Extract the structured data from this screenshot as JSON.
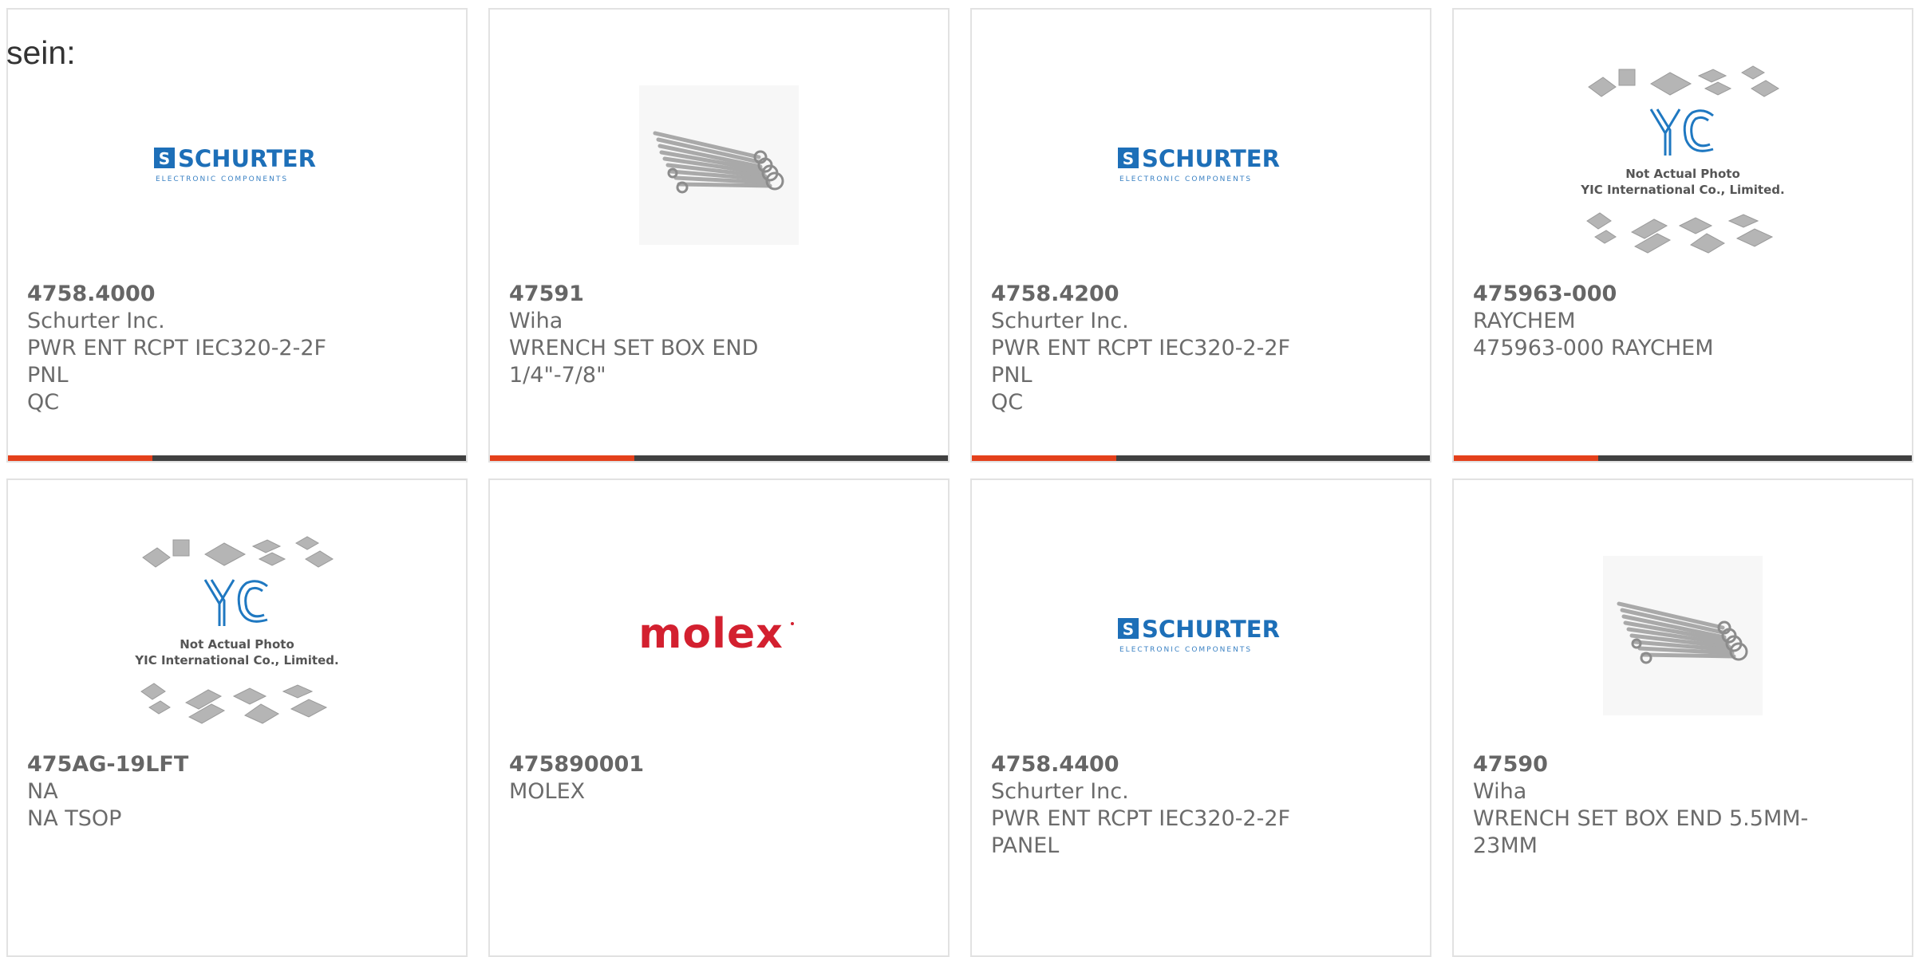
{
  "intro_text": "sein:",
  "accent_color": "#e4401b",
  "products": [
    {
      "part": "4758.4000",
      "maker": "Schurter Inc.",
      "desc1": "PWR ENT RCPT IEC320-2-2F PNL",
      "desc2": "QC",
      "image": "schurter-logo",
      "logo_text": "SCHURTER",
      "logo_sub": "ELECTRONIC COMPONENTS",
      "logo_mark": "S"
    },
    {
      "part": "47591",
      "maker": "Wiha",
      "desc1": "WRENCH SET BOX END 1/4\"-7/8\"",
      "desc2": "",
      "image": "wrench-set-photo"
    },
    {
      "part": "4758.4200",
      "maker": "Schurter Inc.",
      "desc1": "PWR ENT RCPT IEC320-2-2F PNL",
      "desc2": "QC",
      "image": "schurter-logo",
      "logo_text": "SCHURTER",
      "logo_sub": "ELECTRONIC COMPONENTS",
      "logo_mark": "S"
    },
    {
      "part": "475963-000",
      "maker": "RAYCHEM",
      "desc1": "475963-000 RAYCHEM",
      "desc2": "",
      "image": "yic-placeholder",
      "yic_logo": "YIC",
      "yic_line1": "Not Actual Photo",
      "yic_line2": "YIC International Co., Limited."
    },
    {
      "part": "475AG-19LFT",
      "maker": "NA",
      "desc1": "NA TSOP",
      "desc2": "",
      "image": "yic-placeholder",
      "yic_logo": "YIC",
      "yic_line1": "Not Actual Photo",
      "yic_line2": "YIC International Co., Limited."
    },
    {
      "part": "475890001",
      "maker": "MOLEX",
      "desc1": "",
      "desc2": "",
      "image": "molex-logo",
      "logo_text": "molex"
    },
    {
      "part": "4758.4400",
      "maker": "Schurter Inc.",
      "desc1": "PWR ENT RCPT IEC320-2-2F",
      "desc2": "PANEL",
      "image": "schurter-logo",
      "logo_text": "SCHURTER",
      "logo_sub": "ELECTRONIC COMPONENTS",
      "logo_mark": "S"
    },
    {
      "part": "47590",
      "maker": "Wiha",
      "desc1": "WRENCH SET BOX END 5.5MM-",
      "desc2": "23MM",
      "image": "wrench-set-photo"
    }
  ]
}
